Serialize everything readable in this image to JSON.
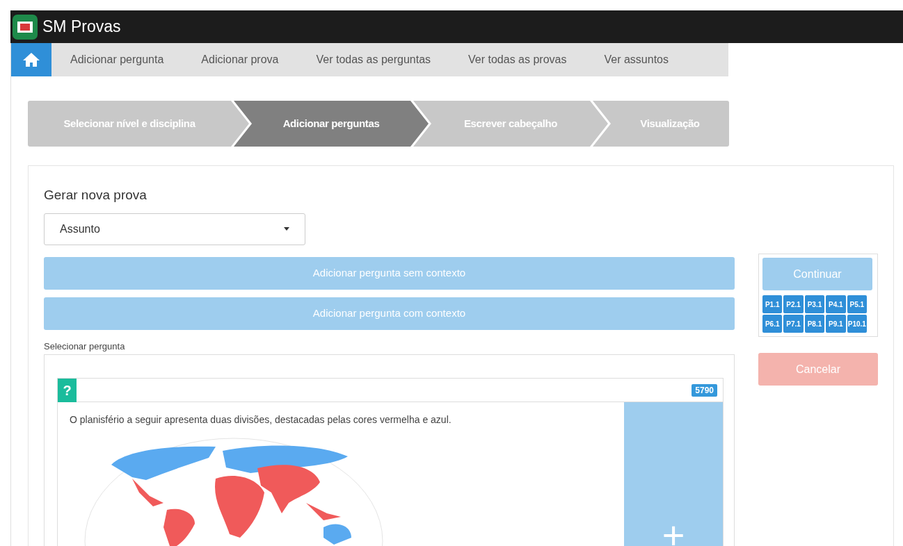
{
  "header": {
    "title": "SM Provas"
  },
  "nav": {
    "items": [
      {
        "label": "Adicionar pergunta"
      },
      {
        "label": "Adicionar prova"
      },
      {
        "label": "Ver todas as perguntas"
      },
      {
        "label": "Ver todas as provas"
      },
      {
        "label": "Ver assuntos"
      }
    ]
  },
  "steps": [
    {
      "label": "Selecionar nível e disciplina",
      "selected": false
    },
    {
      "label": "Adicionar perguntas",
      "selected": true
    },
    {
      "label": "Escrever cabeçalho",
      "selected": false
    },
    {
      "label": "Visualização",
      "selected": false
    }
  ],
  "form": {
    "title": "Gerar nova prova",
    "select": {
      "value": "Assunto"
    },
    "buttons": [
      "Adicionar pergunta sem contexto",
      "Adicionar pergunta com contexto"
    ],
    "section_label": "Selecionar pergunta"
  },
  "question": {
    "badge": "?",
    "id": "5790",
    "text": "O planisfério a seguir apresenta duas divisões, destacadas pelas cores vermelha e azul.",
    "add_symbol": "+"
  },
  "sidebar": {
    "continue": "Continuar",
    "chips": [
      "P1.1",
      "P2.1",
      "P3.1",
      "P4.1",
      "P5.1",
      "P6.1",
      "P7.1",
      "P8.1",
      "P9.1",
      "P10.1"
    ],
    "cancel": "Cancelar"
  }
}
